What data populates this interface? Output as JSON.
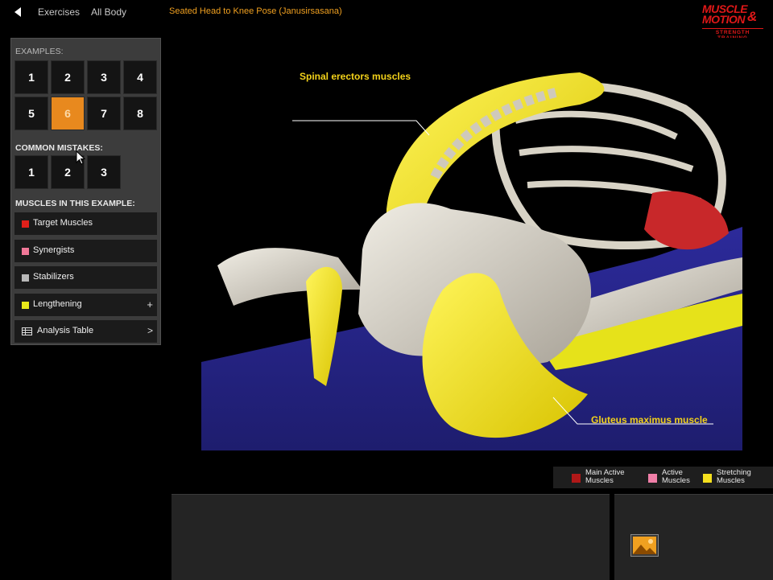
{
  "topbar": {
    "back_icon": "back-arrow-icon",
    "nav": [
      "Exercises",
      "All Body"
    ],
    "title": "Seated Head to Knee Pose (Janusirsasana)",
    "logo": {
      "line1": "MUSCLE",
      "line2": "MOTION",
      "amp": "&",
      "line3": "STRENGTH TRAINING"
    }
  },
  "panel": {
    "examples_label": "EXAMPLES:",
    "examples": [
      "1",
      "2",
      "3",
      "4",
      "5",
      "6",
      "7",
      "8"
    ],
    "active_example": "6",
    "mistakes_label": "COMMON MISTAKES:",
    "mistakes": [
      "1",
      "2",
      "3"
    ],
    "muscles_label": "MUSCLES IN THIS EXAMPLE:",
    "rows": [
      {
        "label": "Target Muscles",
        "color": "#e0201a"
      },
      {
        "label": "Synergists",
        "color": "#f07898"
      },
      {
        "label": "Stabilizers",
        "color": "#b8b8b8"
      },
      {
        "label": "Lengthening",
        "color": "#e8e81a",
        "suffix": "+"
      },
      {
        "label": "Analysis Table",
        "suffix": ">"
      }
    ]
  },
  "viewer": {
    "callouts": [
      "Spinal erectors muscles",
      "Gluteus maximus muscle"
    ]
  },
  "legend": [
    {
      "line1": "Main Active",
      "line2": "Muscles",
      "color": "#b01818"
    },
    {
      "line1": "Active",
      "line2": "Muscles",
      "color": "#f07fa8"
    },
    {
      "line1": "Stretching",
      "line2": "Muscles",
      "color": "#f5e01e"
    }
  ]
}
